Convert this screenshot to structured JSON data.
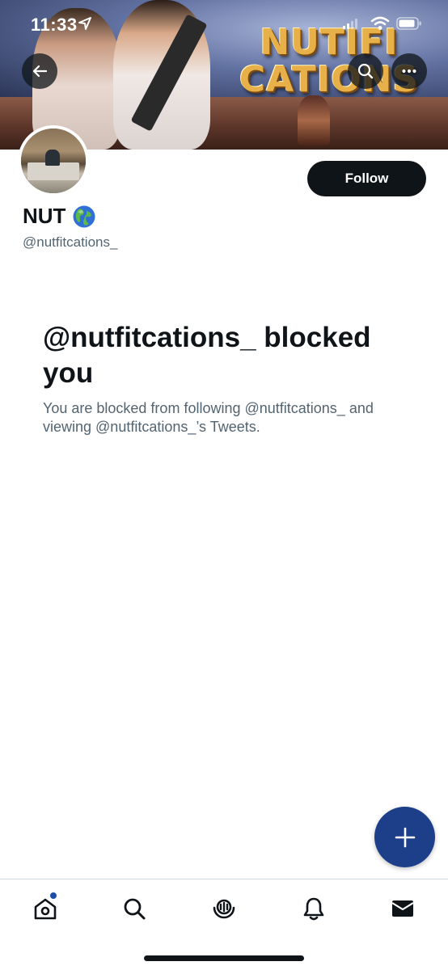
{
  "status_bar": {
    "time": "11:33"
  },
  "banner": {
    "title_line1": "NUTIFI",
    "title_line2": "CATIONS"
  },
  "profile": {
    "display_name": "NUT",
    "name_emoji": "globe-icon",
    "handle": "@nutfitcations_",
    "follow_label": "Follow"
  },
  "blocked": {
    "title": "@nutfitcations_ blocked you",
    "description": "You are blocked from following @nutfitcations_ and viewing @nutfitcations_’s Tweets."
  },
  "colors": {
    "follow_button_bg": "#0f1419",
    "fab_bg": "#1d3f8a",
    "secondary_text": "#536471",
    "notification_dot": "#1d4fa8"
  },
  "bottom_nav": {
    "items": [
      {
        "icon": "home-icon",
        "has_dot": true
      },
      {
        "icon": "search-icon"
      },
      {
        "icon": "spaces-icon"
      },
      {
        "icon": "bell-icon"
      },
      {
        "icon": "mail-icon"
      }
    ]
  }
}
